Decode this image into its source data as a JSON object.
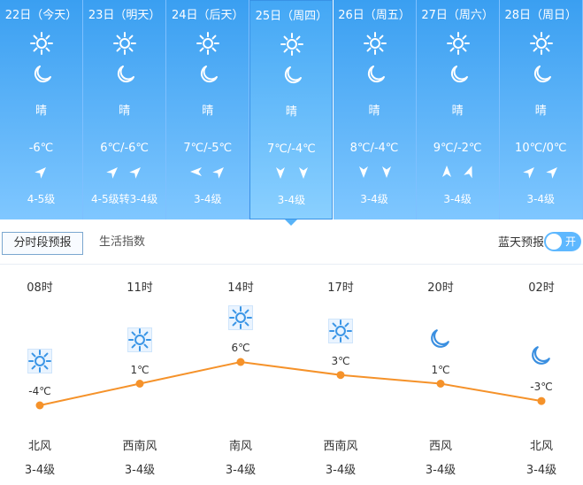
{
  "days": [
    {
      "date": "22日（今天）",
      "cond": "晴",
      "temp": "-6℃",
      "level": "4-5级",
      "wind": [
        "ne",
        "ne"
      ],
      "single": true
    },
    {
      "date": "23日（明天）",
      "cond": "晴",
      "temp": "6℃/-6℃",
      "level": "4-5级转3-4级",
      "wind": [
        "ne",
        "ne"
      ]
    },
    {
      "date": "24日（后天）",
      "cond": "晴",
      "temp": "7℃/-5℃",
      "level": "3-4级",
      "wind": [
        "w",
        "ne"
      ]
    },
    {
      "date": "25日（周四）",
      "cond": "晴",
      "temp": "7℃/-4℃",
      "level": "3-4级",
      "wind": [
        "s",
        "s"
      ]
    },
    {
      "date": "26日（周五）",
      "cond": "晴",
      "temp": "8℃/-4℃",
      "level": "3-4级",
      "wind": [
        "s",
        "s"
      ]
    },
    {
      "date": "27日（周六）",
      "cond": "晴",
      "temp": "9℃/-2℃",
      "level": "3-4级",
      "wind": [
        "n",
        "nne"
      ]
    },
    {
      "date": "28日（周日）",
      "cond": "晴",
      "temp": "10℃/0℃",
      "level": "3-4级",
      "wind": [
        "ne",
        "ne"
      ]
    }
  ],
  "tabs": {
    "hourly": "分时段预报",
    "life": "生活指数"
  },
  "toggle": {
    "label": "蓝天预报",
    "state": "开"
  },
  "hourly": [
    {
      "time": "08时",
      "temp": -4,
      "temp_label": "-4℃",
      "icon": "sun",
      "wind": "北风",
      "level": "3-4级"
    },
    {
      "time": "11时",
      "temp": 1,
      "temp_label": "1℃",
      "icon": "sun",
      "wind": "西南风",
      "level": "3-4级"
    },
    {
      "time": "14时",
      "temp": 6,
      "temp_label": "6℃",
      "icon": "sun",
      "wind": "南风",
      "level": "3-4级"
    },
    {
      "time": "17时",
      "temp": 3,
      "temp_label": "3℃",
      "icon": "sun",
      "wind": "西南风",
      "level": "3-4级"
    },
    {
      "time": "20时",
      "temp": 1,
      "temp_label": "1℃",
      "icon": "moon",
      "wind": "西风",
      "level": "3-4级"
    },
    {
      "time": "02时",
      "temp": -3,
      "temp_label": "-3℃",
      "icon": "moon",
      "wind": "北风",
      "level": "3-4级"
    }
  ],
  "colors": {
    "line": "#f5922a",
    "sun": "#3a95e6",
    "moon": "#3a8fe0"
  }
}
